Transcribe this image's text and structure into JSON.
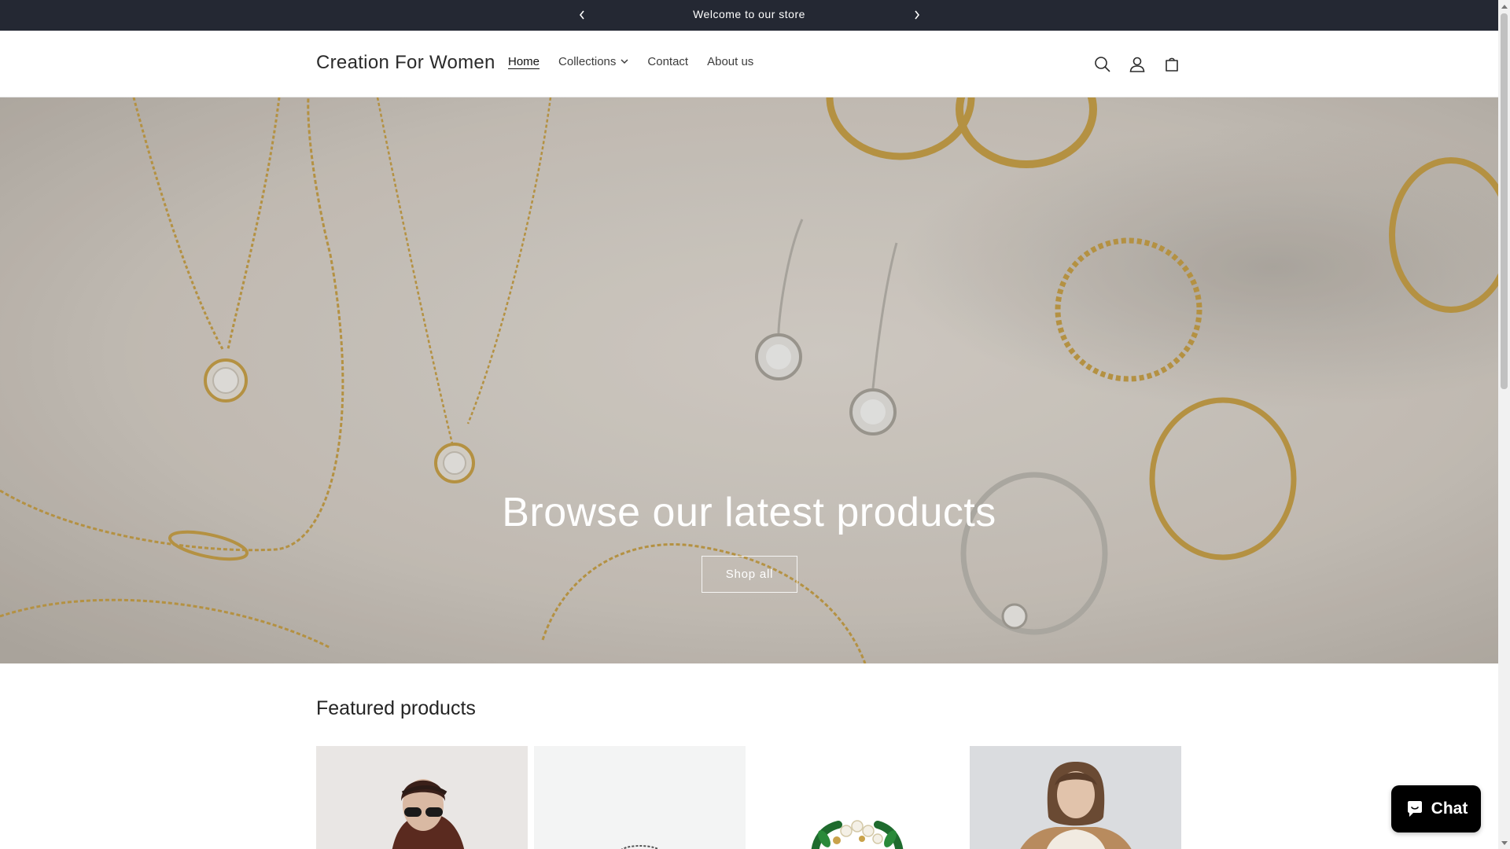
{
  "announcement": {
    "text": "Welcome to our store",
    "prev_icon": "chevron-left-icon",
    "next_icon": "chevron-right-icon",
    "background": "#242833"
  },
  "header": {
    "logo": "Creation For Women",
    "nav": [
      {
        "label": "Home",
        "active": true
      },
      {
        "label": "Collections",
        "has_dropdown": true
      },
      {
        "label": "Contact"
      },
      {
        "label": "About us"
      }
    ],
    "icons": [
      "search-icon",
      "account-icon",
      "cart-icon"
    ]
  },
  "hero": {
    "title": "Browse our latest products",
    "button_label": "Shop all"
  },
  "featured": {
    "title": "Featured products",
    "products": [
      {
        "image": "woman-in-sunglasses"
      },
      {
        "image": "silver-ring"
      },
      {
        "image": "pearl-leaf-brooch"
      },
      {
        "image": "woman-in-shearling-jacket"
      }
    ]
  },
  "chat": {
    "label": "Chat",
    "icon": "chat-bubble-icon"
  }
}
